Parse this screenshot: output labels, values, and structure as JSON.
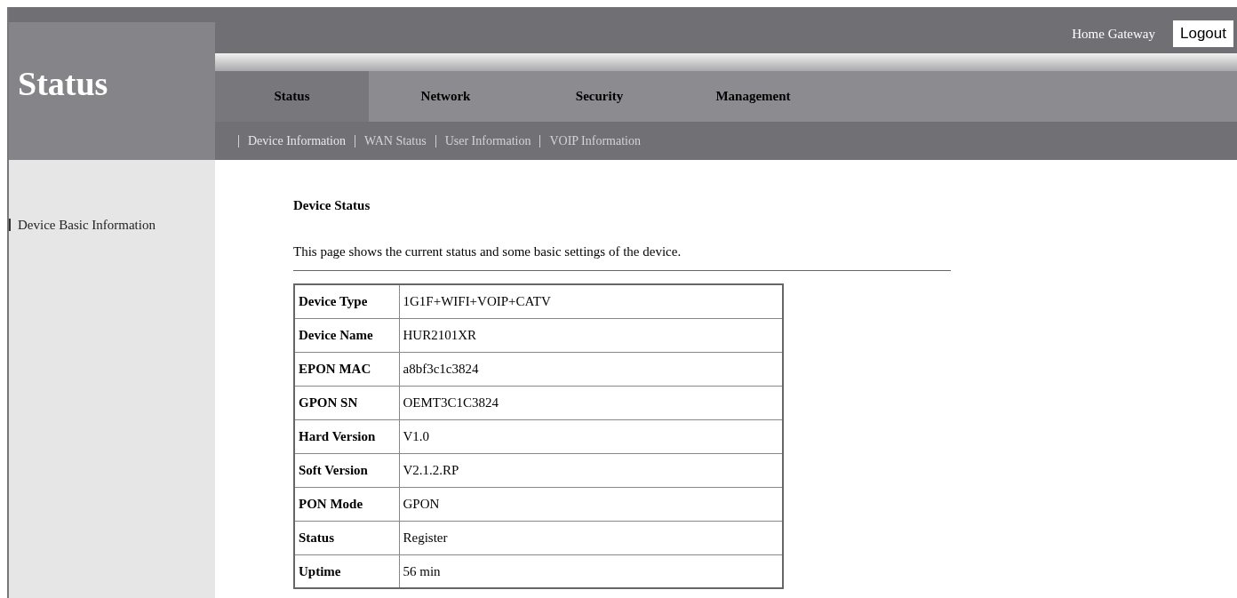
{
  "header": {
    "title": "Status",
    "gateway_label": "Home Gateway",
    "logout": "Logout"
  },
  "tabs": [
    {
      "label": "Status",
      "selected": true
    },
    {
      "label": "Network",
      "selected": false
    },
    {
      "label": "Security",
      "selected": false
    },
    {
      "label": "Management",
      "selected": false
    }
  ],
  "subnav": [
    {
      "label": "Device Information",
      "selected": true
    },
    {
      "label": "WAN Status",
      "selected": false
    },
    {
      "label": "User Information",
      "selected": false
    },
    {
      "label": "VOIP Information",
      "selected": false
    }
  ],
  "sidebar": {
    "items": [
      {
        "label": "Device Basic Information",
        "selected": true
      }
    ]
  },
  "content": {
    "heading": "Device Status",
    "description": "This page shows the current status and some basic settings of the device.",
    "table": {
      "rows": [
        {
          "label": "Device Type",
          "value": "1G1F+WIFI+VOIP+CATV"
        },
        {
          "label": "Device Name",
          "value": "HUR2101XR"
        },
        {
          "label": "EPON MAC",
          "value": "a8bf3c1c3824"
        },
        {
          "label": "GPON SN",
          "value": "OEMT3C1C3824"
        },
        {
          "label": "Hard Version",
          "value": "V1.0"
        },
        {
          "label": "Soft Version",
          "value": "V2.1.2.RP"
        },
        {
          "label": "PON Mode",
          "value": "GPON"
        },
        {
          "label": "Status",
          "value": "Register"
        },
        {
          "label": "Uptime",
          "value": "56 min"
        }
      ]
    }
  }
}
